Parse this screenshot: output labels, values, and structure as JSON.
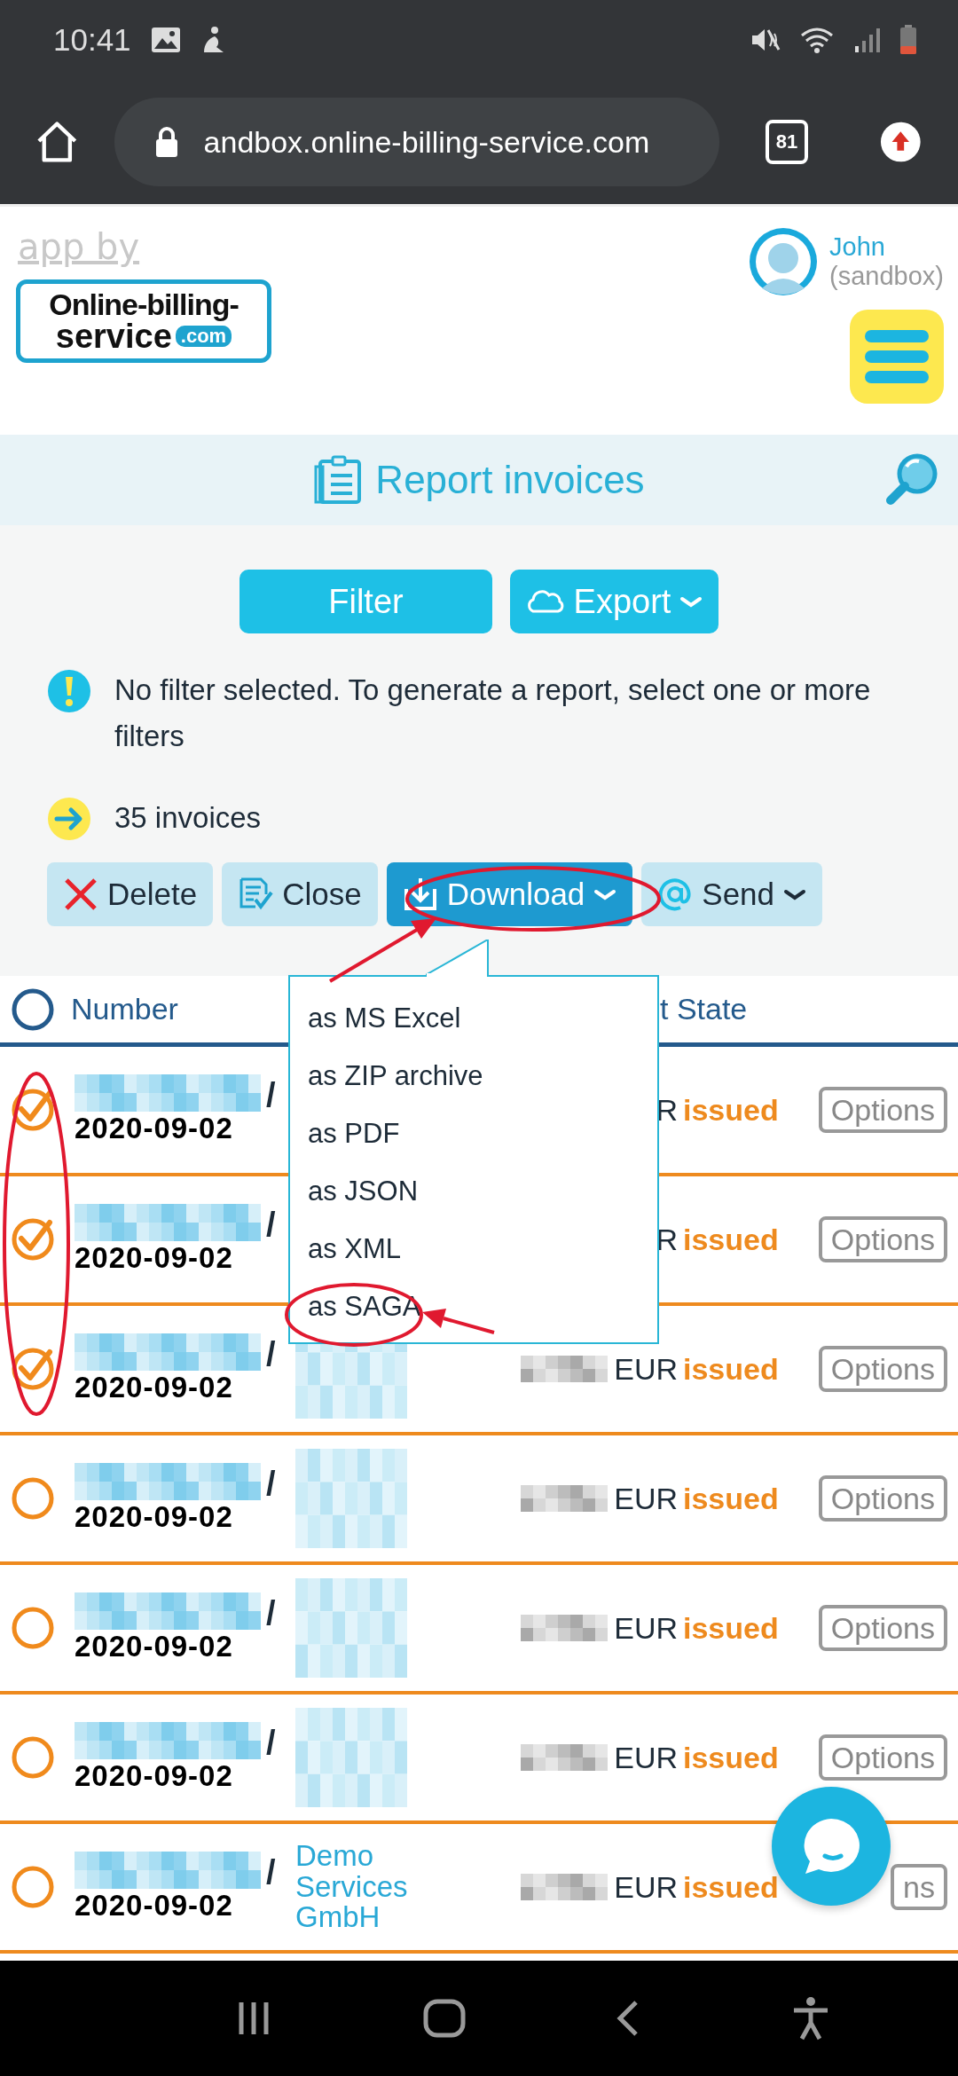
{
  "status_bar": {
    "time": "10:41"
  },
  "browser": {
    "url": "andbox.online-billing-service.com",
    "tab_count": "81"
  },
  "header": {
    "tagline": "app by",
    "logo": {
      "line1": "Online-billing-",
      "line2": "service",
      "badge": ".com"
    },
    "user": {
      "name": "John",
      "account": "(sandbox)"
    }
  },
  "page_title": "Report invoices",
  "top_buttons": [
    {
      "label": "Filter",
      "kind": "plain",
      "dropdown": false
    },
    {
      "label": "Export",
      "kind": "cloud",
      "dropdown": true
    }
  ],
  "notices": [
    {
      "kind": "warning",
      "text": "No filter selected. To generate a report, select one or more filters"
    },
    {
      "kind": "count",
      "text": "35 invoices"
    }
  ],
  "actions": [
    {
      "label": "Delete",
      "kind": "delete",
      "dropdown": false,
      "active": false
    },
    {
      "label": "Close",
      "kind": "close",
      "dropdown": false,
      "active": false
    },
    {
      "label": "Download",
      "kind": "download",
      "dropdown": true,
      "active": true,
      "menu": [
        "as MS Excel",
        "as ZIP archive",
        "as PDF",
        "as JSON",
        "as XML",
        "as SAGA"
      ]
    },
    {
      "label": "Send",
      "kind": "send",
      "dropdown": true,
      "active": false
    }
  ],
  "table": {
    "select_all": {
      "checked": false
    },
    "columns": [
      "Number",
      "t State"
    ],
    "rows": [
      {
        "checked": true,
        "number_sep": "/",
        "date": "2020-09-02",
        "currency": "R",
        "state": "issued",
        "options": "Options"
      },
      {
        "checked": true,
        "number_sep": "/",
        "date": "2020-09-02",
        "currency": "R",
        "state": "issued",
        "options": "Options"
      },
      {
        "checked": true,
        "number_sep": "/",
        "date": "2020-09-02",
        "customer_redacted": true,
        "currency": "EUR",
        "state": "issued",
        "options": "Options"
      },
      {
        "checked": false,
        "number_sep": "/",
        "date": "2020-09-02",
        "customer_redacted": true,
        "currency": "EUR",
        "state": "issued",
        "options": "Options"
      },
      {
        "checked": false,
        "number_sep": "/",
        "date": "2020-09-02",
        "customer_redacted": true,
        "currency": "EUR",
        "state": "issued",
        "options": "Options"
      },
      {
        "checked": false,
        "number_sep": "/",
        "date": "2020-09-02",
        "customer_redacted": true,
        "currency": "EUR",
        "state": "issued",
        "options": "Options"
      },
      {
        "checked": false,
        "number_sep": "/",
        "date": "2020-09-02",
        "customer": "Demo Services GmbH",
        "currency": "EUR",
        "state": "issued",
        "options": "ns"
      }
    ]
  }
}
